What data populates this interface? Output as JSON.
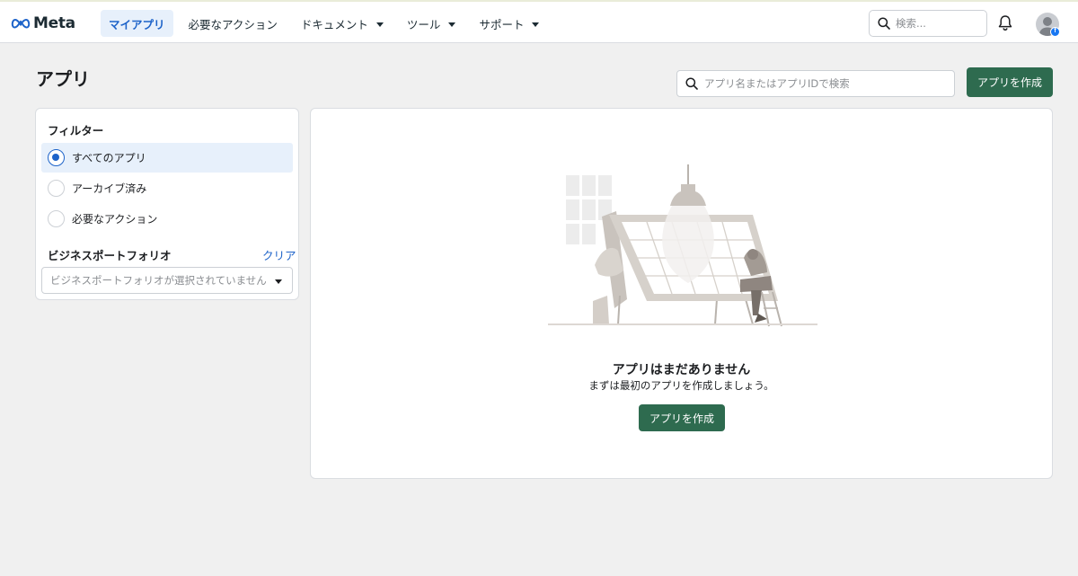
{
  "brand": {
    "logo_text": "Meta"
  },
  "nav": {
    "items": [
      {
        "label": "マイアプリ",
        "active": true,
        "dropdown": false
      },
      {
        "label": "必要なアクション",
        "active": false,
        "dropdown": false
      },
      {
        "label": "ドキュメント",
        "active": false,
        "dropdown": true
      },
      {
        "label": "ツール",
        "active": false,
        "dropdown": true
      },
      {
        "label": "サポート",
        "active": false,
        "dropdown": true
      }
    ],
    "search_placeholder": "検索...",
    "icons": [
      "search-icon",
      "bell-icon",
      "avatar",
      "facebook-badge-icon"
    ]
  },
  "page": {
    "title": "アプリ",
    "search_placeholder": "アプリ名またはアプリIDで検索",
    "create_button": "アプリを作成"
  },
  "filter": {
    "title": "フィルター",
    "options": [
      {
        "label": "すべてのアプリ",
        "selected": true
      },
      {
        "label": "アーカイブ済み",
        "selected": false
      },
      {
        "label": "必要なアクション",
        "selected": false
      }
    ],
    "business_portfolio": {
      "title": "ビジネスポートフォリオ",
      "clear_label": "クリア",
      "select_value": "ビジネスポートフォリオが選択されていません"
    }
  },
  "empty_state": {
    "title": "アプリはまだありません",
    "subtitle": "まずは最初のアプリを作成しましょう。",
    "button": "アプリを作成"
  },
  "colors": {
    "accent_blue": "#1d63c9",
    "primary_green": "#2e6b4f",
    "active_nav_bg": "#e7f0fb",
    "page_bg": "#f0f0f0"
  }
}
